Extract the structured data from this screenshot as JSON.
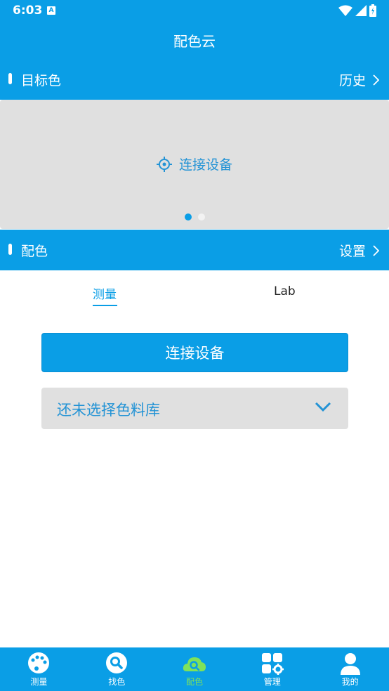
{
  "status": {
    "time": "6:03",
    "badge": "A"
  },
  "header": {
    "title": "配色云"
  },
  "target_section": {
    "label": "目标色",
    "link": "历史"
  },
  "target_area": {
    "connect_text": "连接设备"
  },
  "match_section": {
    "label": "配色",
    "link": "设置"
  },
  "tabs": [
    {
      "label": "测量",
      "active": true
    },
    {
      "label": "Lab",
      "active": false
    }
  ],
  "connect_button": {
    "label": "连接设备"
  },
  "library_select": {
    "value": "还未选择色料库"
  },
  "bottom_nav": [
    {
      "label": "测量",
      "icon": "palette-icon"
    },
    {
      "label": "找色",
      "icon": "search-icon"
    },
    {
      "label": "配色",
      "icon": "cloud-match-icon",
      "active": true
    },
    {
      "label": "管理",
      "icon": "grid-manage-icon"
    },
    {
      "label": "我的",
      "icon": "person-icon"
    }
  ],
  "colors": {
    "primary": "#0a9ee6",
    "active_nav": "#7fe25a",
    "panel_gray": "#e0e0e0"
  }
}
